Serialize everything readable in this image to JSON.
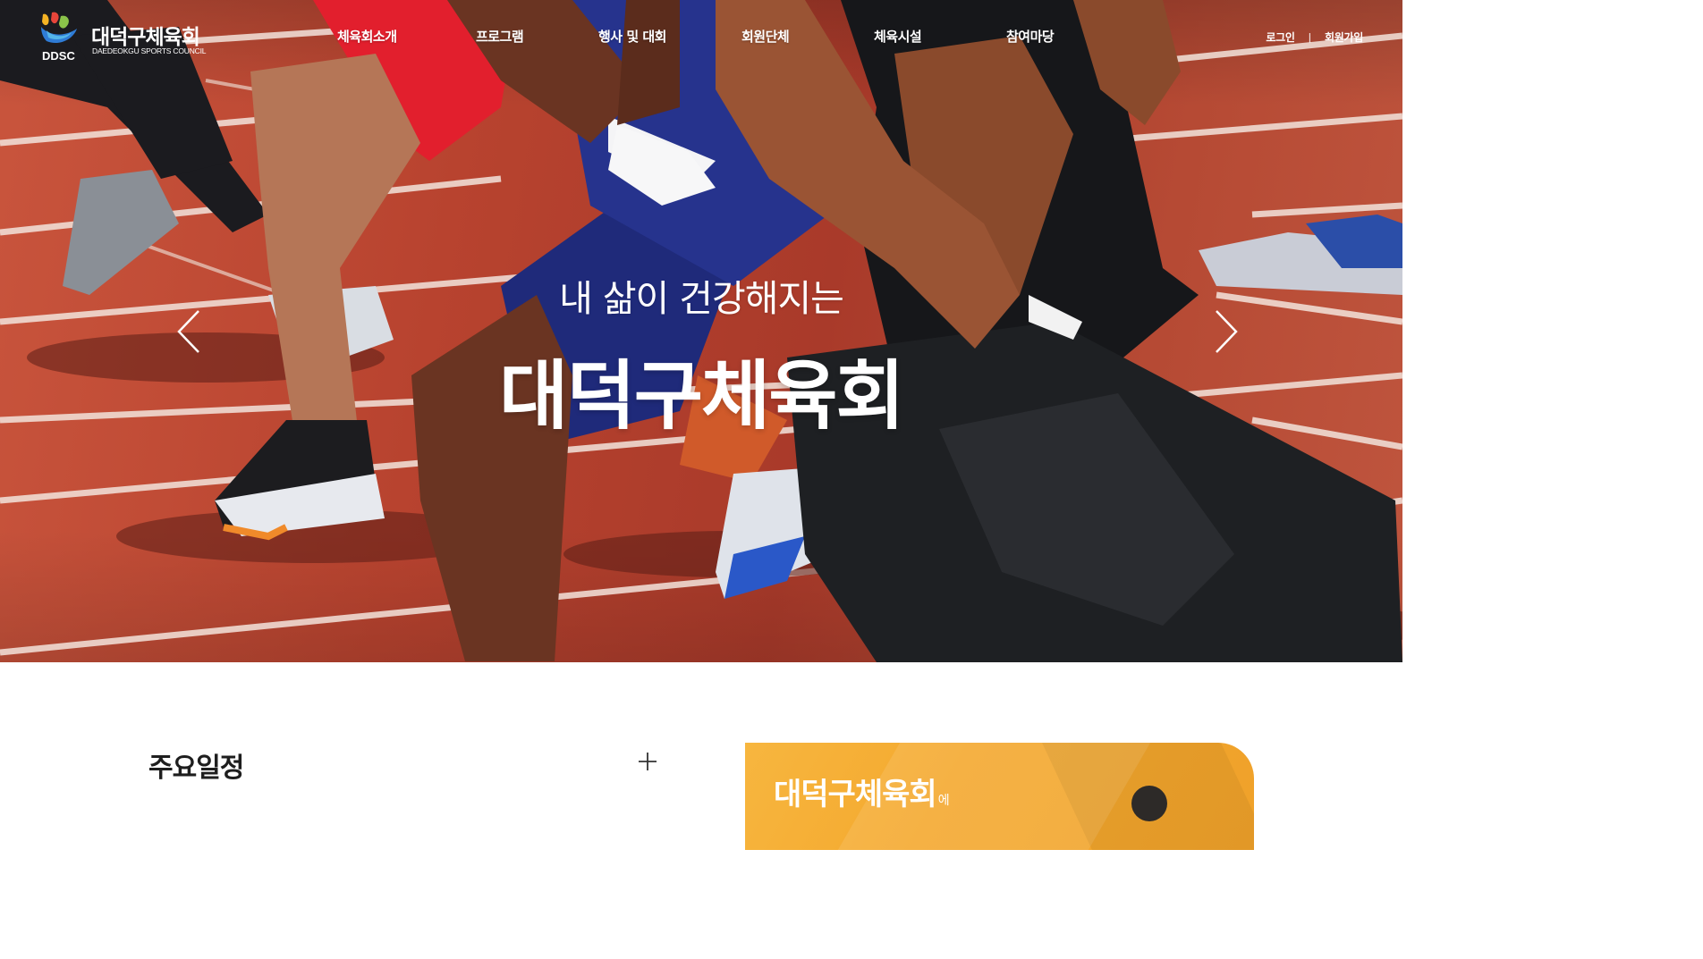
{
  "header": {
    "logo": {
      "abbr": "DDSC",
      "name_ko": "대덕구체육회",
      "name_en": "DAEDEOKGU SPORTS COUNCIL"
    },
    "nav": [
      {
        "label": "체육회소개"
      },
      {
        "label": "프로그램"
      },
      {
        "label": "행사 및 대회"
      },
      {
        "label": "회원단체"
      },
      {
        "label": "체육시설"
      },
      {
        "label": "참여마당"
      }
    ],
    "util": {
      "login": "로그인",
      "separator": "|",
      "signup": "회원가입"
    }
  },
  "hero": {
    "subtitle": "내 삶이 건강해지는",
    "title": "대덕구체육회",
    "prev_icon": "chevron-left-icon",
    "next_icon": "chevron-right-icon"
  },
  "schedule": {
    "title": "주요일정",
    "more_icon": "plus-icon"
  },
  "promo": {
    "title": "대덕구체육회",
    "suffix": "에"
  },
  "colors": {
    "track_red": "#b8432f",
    "promo_orange": "#f4a92f",
    "text_dark": "#1e1e1e",
    "white": "#ffffff"
  }
}
